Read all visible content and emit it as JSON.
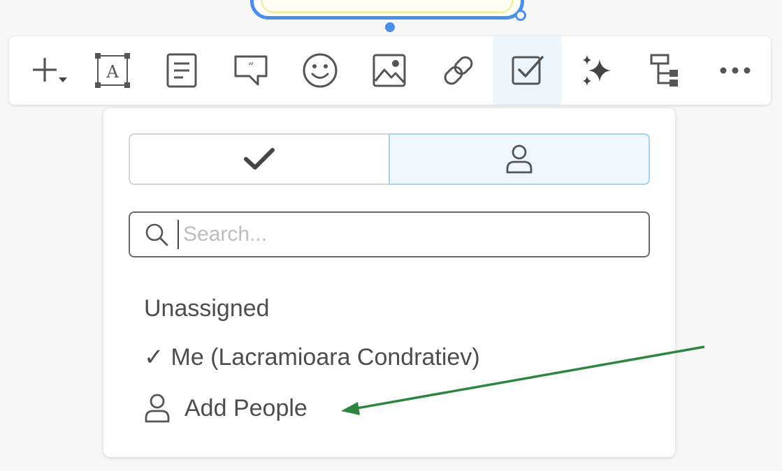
{
  "toolbar": {
    "items": [
      {
        "icon": "add-icon",
        "active": false
      },
      {
        "icon": "text-box-icon",
        "active": false
      },
      {
        "icon": "note-icon",
        "active": false
      },
      {
        "icon": "comment-icon",
        "active": false
      },
      {
        "icon": "emoji-icon",
        "active": false
      },
      {
        "icon": "image-icon",
        "active": false
      },
      {
        "icon": "link-icon",
        "active": false
      },
      {
        "icon": "task-checkbox-icon",
        "active": true
      },
      {
        "icon": "ai-sparkle-icon",
        "active": false
      },
      {
        "icon": "mind-map-icon",
        "active": false
      },
      {
        "icon": "more-icon",
        "active": false
      }
    ]
  },
  "assign_panel": {
    "tabs": [
      {
        "icon": "checkmark-icon",
        "selected": false
      },
      {
        "icon": "person-icon",
        "selected": true
      }
    ],
    "search": {
      "placeholder": "Search...",
      "value": ""
    },
    "options": {
      "unassigned": "Unassigned",
      "me_check": "✓",
      "me": "Me (Lacramioara Condratiev)",
      "add_people": "Add People"
    }
  },
  "colors": {
    "selection_blue": "#4a8fe8",
    "active_tab_bg": "#f0f7fd",
    "annotation_arrow": "#2e8540",
    "icon_gray": "#555555"
  }
}
